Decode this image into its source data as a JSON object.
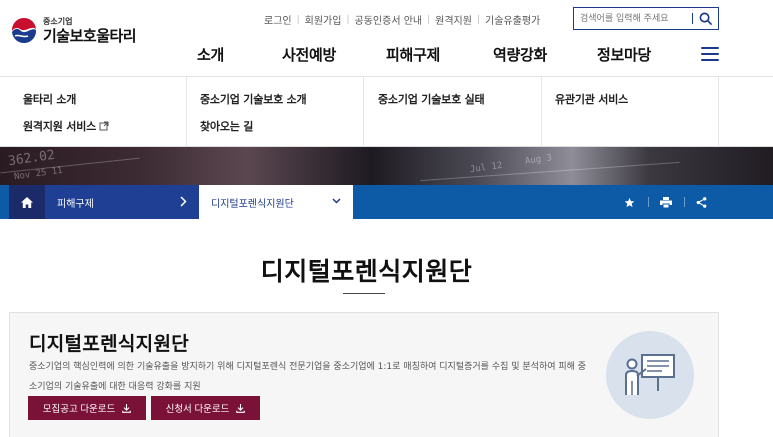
{
  "header": {
    "logo_sub": "중소기업",
    "logo_main": "기술보호울타리",
    "util_links": [
      "로그인",
      "회원가입",
      "공동인증서 안내",
      "원격지원",
      "기술유출평가"
    ],
    "search": {
      "placeholder": "검색어를 입력해 주세요"
    },
    "gnb": [
      "소개",
      "사전예방",
      "피해구제",
      "역량강화",
      "정보마당"
    ]
  },
  "submenu": {
    "col1": [
      "울타리 소개",
      "원격지원 서비스"
    ],
    "col2": [
      "중소기업 기술보호 소개",
      "찾아오는 길"
    ],
    "col3": [
      "중소기업 기술보호 실태"
    ],
    "col4": [
      "유관기관 서비스"
    ]
  },
  "hero": {
    "overlay_texts": [
      "362.02",
      "Nov 25 11",
      "Jul 12",
      "Aug 3"
    ]
  },
  "breadcrumb": {
    "level1": "피해구제",
    "level2": "디지털포렌식지원단"
  },
  "page": {
    "title": "디지털포렌식지원단",
    "box_title": "디지털포렌식지원단",
    "box_desc": "중소기업의 핵심인력에 의한 기술유출을 방지하기 위해 디지털포렌식 전문기업을 중소기업에 1:1로 매칭하여 디지털증거를 수집 및 분석하여 피해 중소기업의 기술유출에 대한 대응력 강화를 지원",
    "buttons": [
      "모집공고 다운로드",
      "신청서 다운로드"
    ]
  },
  "colors": {
    "primary_blue": "#1c3a8c",
    "location_bar": "#0d5aa7",
    "button_maroon": "#7a1136"
  }
}
